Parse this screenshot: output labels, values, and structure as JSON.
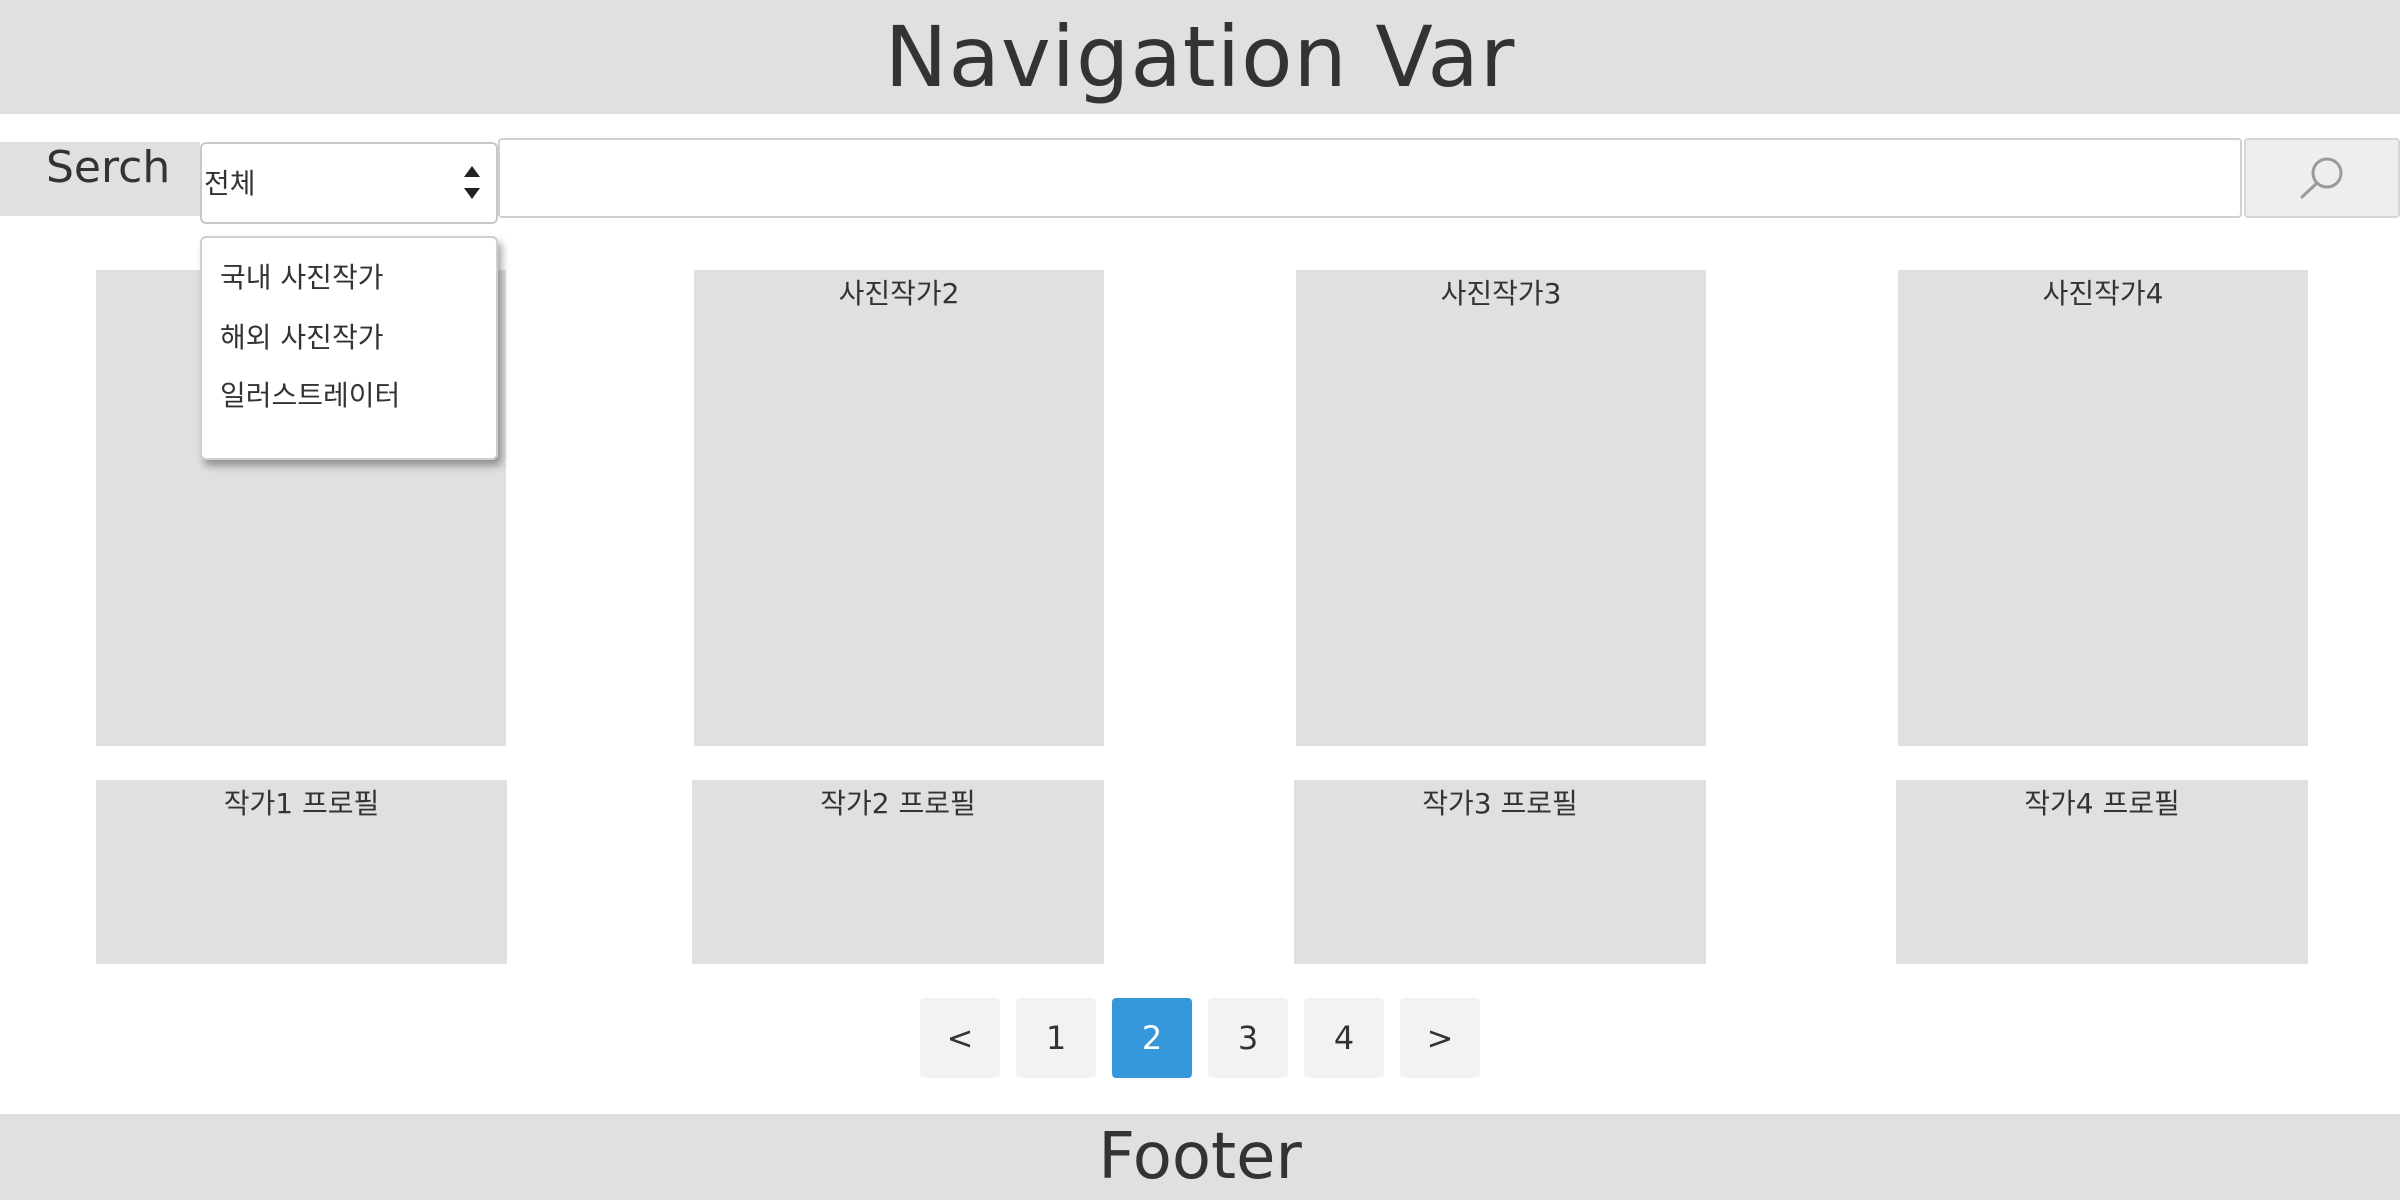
{
  "navbar": {
    "title": "Navigation Var"
  },
  "search": {
    "label": "Serch",
    "category_value": "전체",
    "input_value": "",
    "input_placeholder": "",
    "button_icon": "search-icon"
  },
  "dropdown": {
    "options": [
      "국내 사진작가",
      "해외 사진작가",
      "일러스트레이터"
    ]
  },
  "photographers": [
    {
      "title": ""
    },
    {
      "title": "사진작가2"
    },
    {
      "title": "사진작가3"
    },
    {
      "title": "사진작가4"
    }
  ],
  "profiles": [
    {
      "title": "작가1 프로필"
    },
    {
      "title": "작가2 프로필"
    },
    {
      "title": "작가3 프로필"
    },
    {
      "title": "작가4 프로필"
    }
  ],
  "pagination": {
    "prev": "<",
    "pages": [
      "1",
      "2",
      "3",
      "4"
    ],
    "active_page": "2",
    "next": ">"
  },
  "footer": {
    "title": "Footer"
  },
  "colors": {
    "panel": "#e0e0e0",
    "accent": "#3498db",
    "text": "#333333"
  }
}
